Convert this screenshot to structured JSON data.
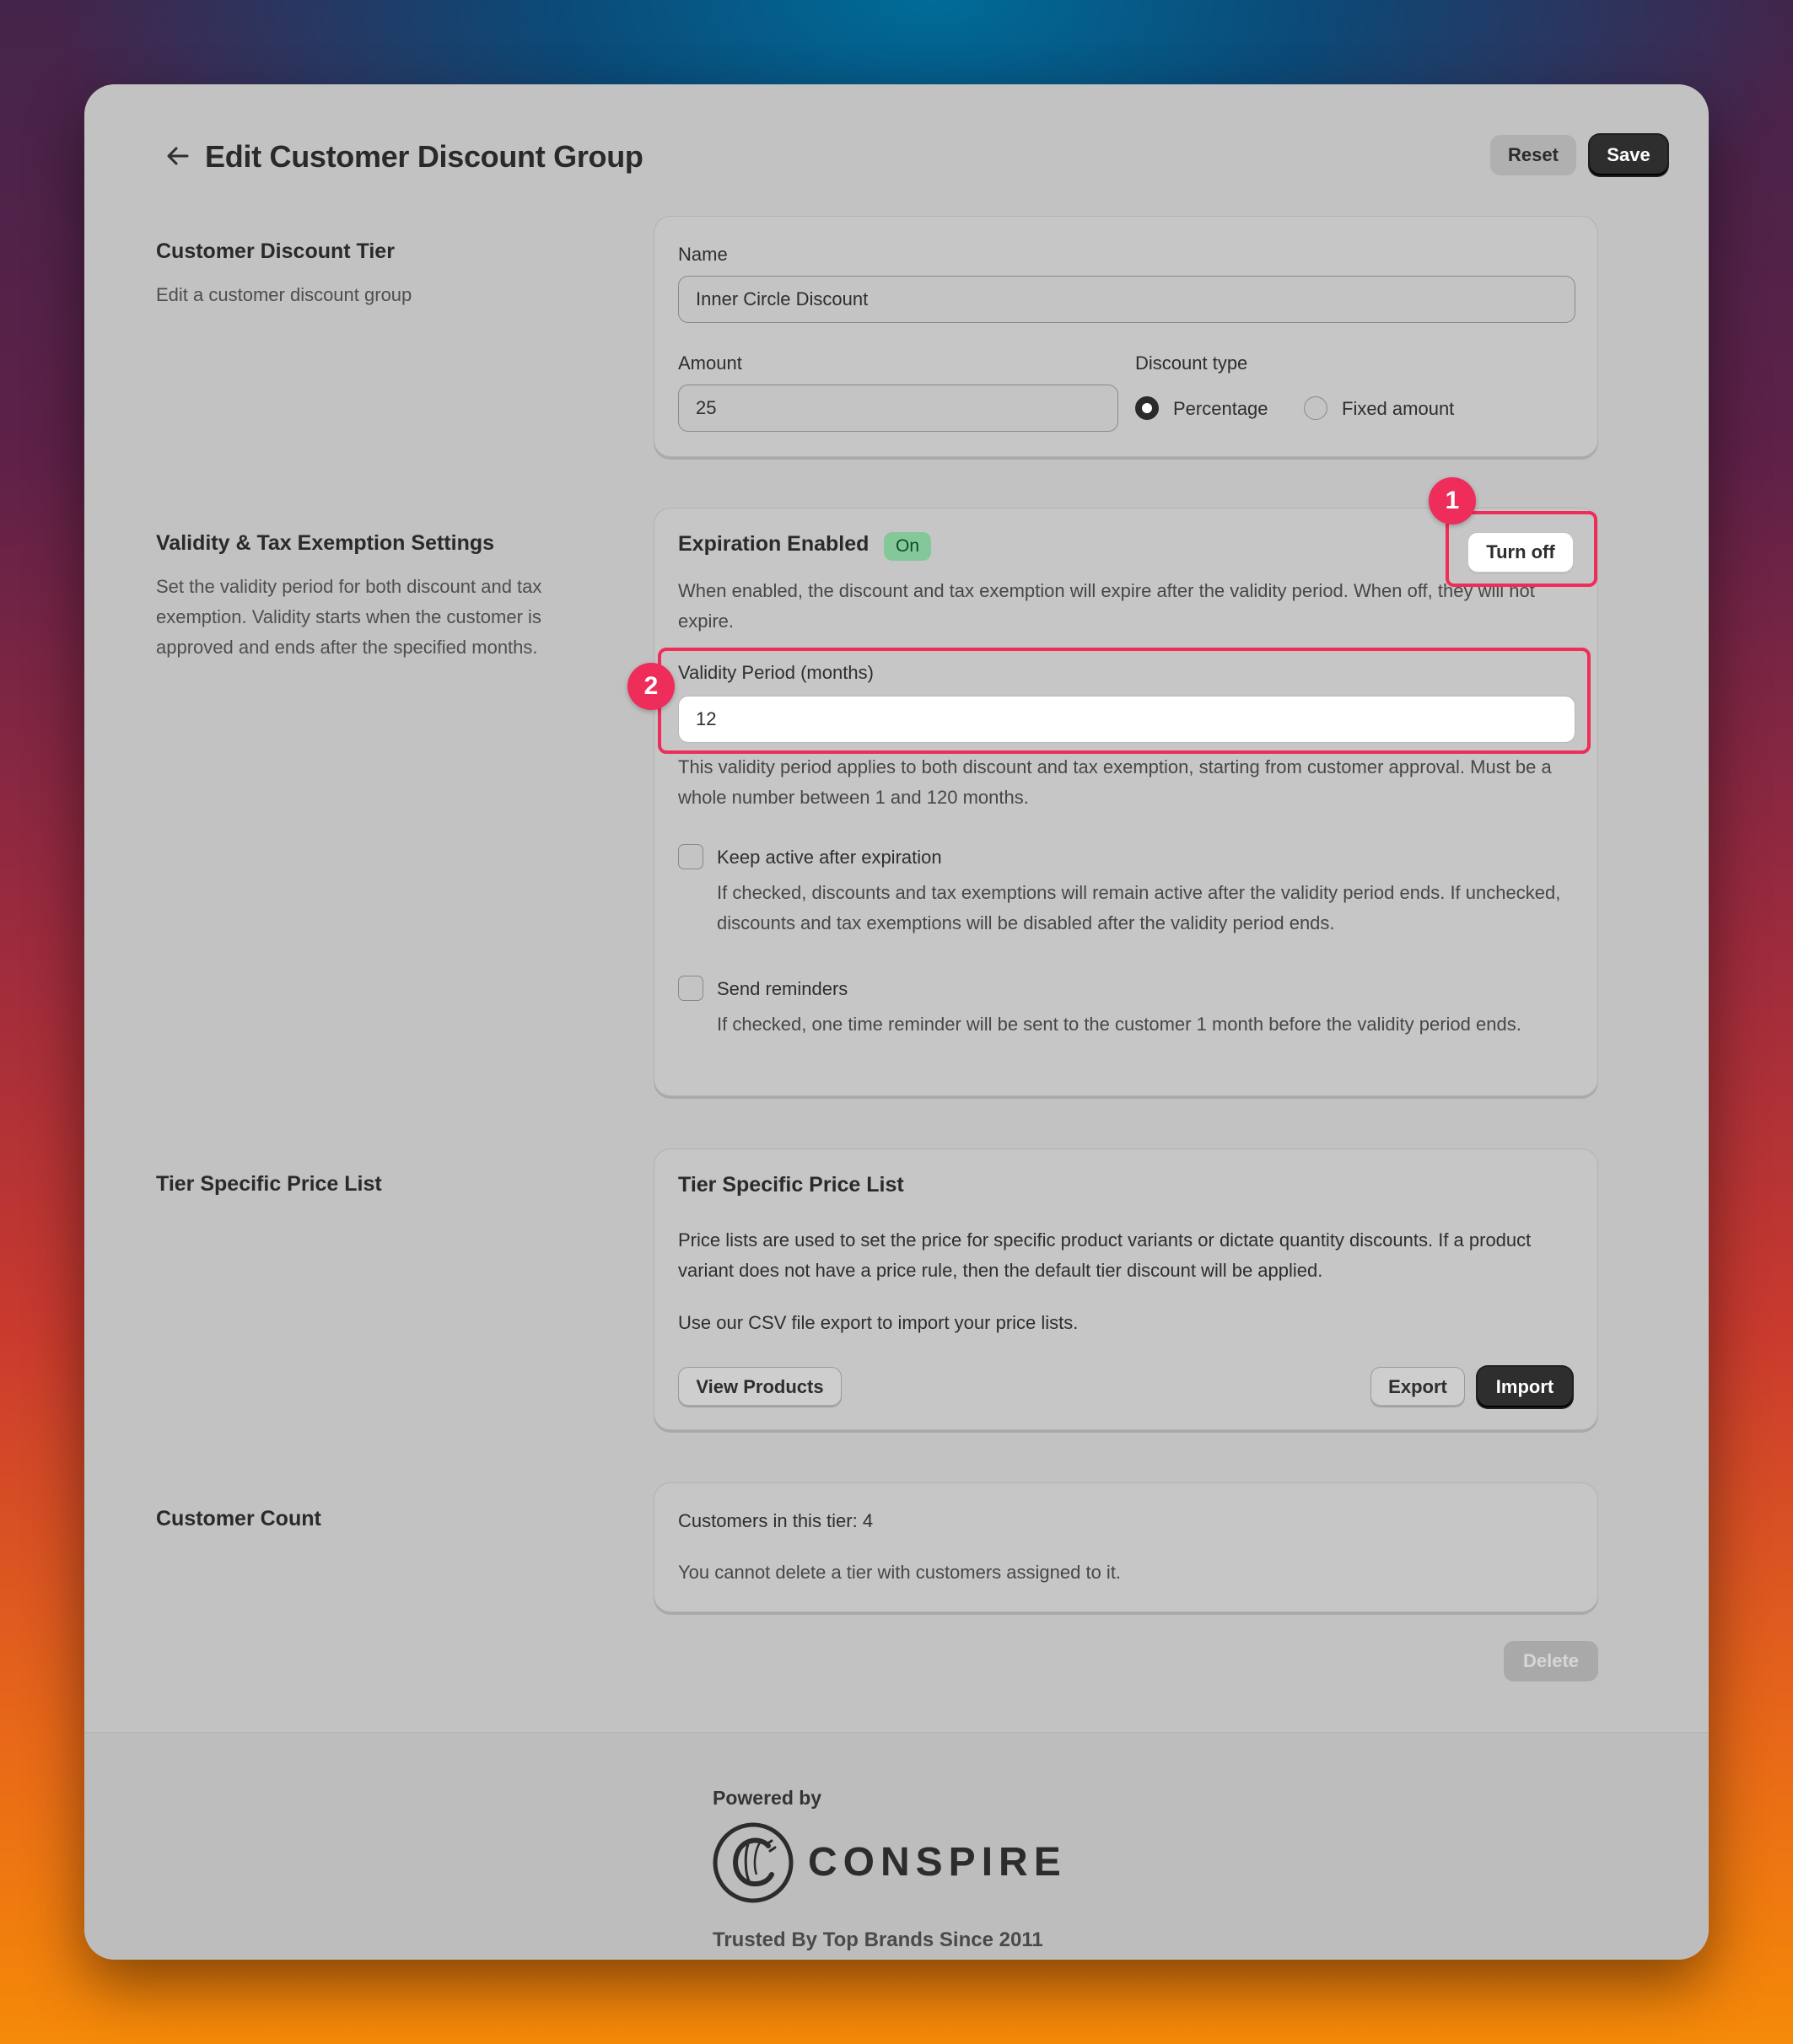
{
  "header": {
    "title": "Edit Customer Discount Group",
    "reset_label": "Reset",
    "save_label": "Save"
  },
  "tier_section": {
    "title": "Customer Discount Tier",
    "description": "Edit a customer discount group",
    "name_label": "Name",
    "name_value": "Inner Circle Discount",
    "amount_label": "Amount",
    "amount_value": "25",
    "discount_type_label": "Discount type",
    "discount_type_options": [
      "Percentage",
      "Fixed amount"
    ],
    "discount_type_selected": "Percentage"
  },
  "validity_section": {
    "title": "Validity & Tax Exemption Settings",
    "description": "Set the validity period for both discount and tax exemption. Validity starts when the customer is approved and ends after the specified months.",
    "card_title": "Expiration Enabled",
    "status_badge": "On",
    "turn_off_label": "Turn off",
    "expiration_help": "When enabled, the discount and tax exemption will expire after the validity period. When off, they will not expire.",
    "period_label": "Validity Period (months)",
    "period_value": "12",
    "period_help": "This validity period applies to both discount and tax exemption, starting from customer approval. Must be a whole number between 1 and 120 months.",
    "keep_active_label": "Keep active after expiration",
    "keep_active_help": "If checked, discounts and tax exemptions will remain active after the validity period ends. If unchecked, discounts and tax exemptions will be disabled after the validity period ends.",
    "reminders_label": "Send reminders",
    "reminders_help": "If checked, one time reminder will be sent to the customer 1 month before the validity period ends."
  },
  "price_list_section": {
    "title": "Tier Specific Price List",
    "card_title": "Tier Specific Price List",
    "paragraph1": "Price lists are used to set the price for specific product variants or dictate quantity discounts. If a product variant does not have a price rule, then the default tier discount will be applied.",
    "paragraph2": "Use our CSV file export to import your price lists.",
    "view_products_label": "View Products",
    "export_label": "Export",
    "import_label": "Import"
  },
  "customer_count_section": {
    "title": "Customer Count",
    "count_text": "Customers in this tier: 4",
    "delete_note": "You cannot delete a tier with customers assigned to it.",
    "delete_label": "Delete"
  },
  "annotations": {
    "marker1": "1",
    "marker2": "2",
    "color": "#ee2d5a"
  },
  "footer": {
    "powered_by": "Powered by",
    "brand": "CONSPIRE",
    "tagline": "Trusted By Top Brands Since 2011"
  },
  "icons": {
    "back": "arrow-left-icon",
    "logo": "conspire-logo-icon"
  }
}
